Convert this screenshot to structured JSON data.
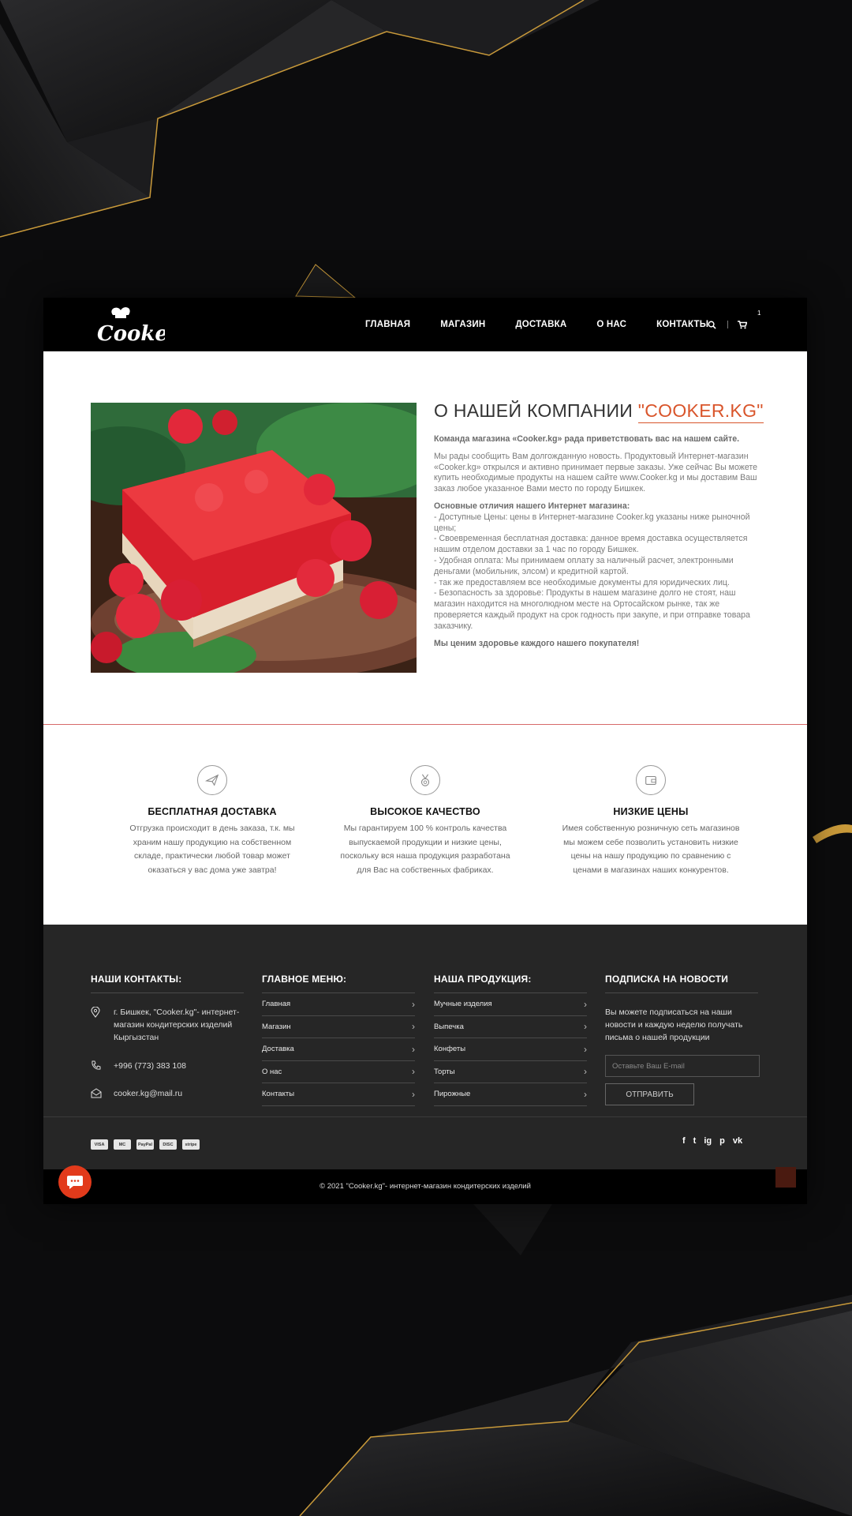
{
  "header": {
    "logo_text": "Cooker",
    "nav": [
      "ГЛАВНАЯ",
      "МАГАЗИН",
      "ДОСТАВКА",
      "О НАС",
      "КОНТАКТЫ"
    ],
    "cart_count": "1"
  },
  "about": {
    "title_prefix": "О НАШЕЙ КОМПАНИИ ",
    "title_accent": "\"COOKER.KG\"",
    "intro": "Команда магазина «Cooker.kg» рада приветствовать вас на нашем сайте.",
    "p1": "Мы рады сообщить Вам долгожданную новость. Продуктовый Интернет-магазин «Cooker.kg» открылся и активно принимает первые заказы. Уже сейчас Вы можете купить необходимые продукты на нашем сайте www.Cooker.kg и мы доставим Ваш заказ любое указанное Вами место по городу Бишкек.",
    "diff_title": "Основные отличия нашего Интернет магазина:",
    "diff_list": [
      "- Доступные Цены: цены в Интернет-магазине Cooker.kg указаны ниже рыночной цены;",
      "- Своевременная бесплатная доставка: данное время доставка осуществляется нашим отделом доставки за 1 час по городу Бишкек.",
      "- Удобная оплата: Мы принимаем оплату за наличный расчет, электронными деньгами (мобильник, элсом) и кредитной картой.",
      "- так же предоставляем все необходимые документы для юридических лиц.",
      "- Безопасность за здоровье: Продукты в нашем магазине долго не стоят, наш магазин находится на многолюдном месте на Ортосайском рынке, так же проверяется каждый продукт на срок годность при закупе, и при отправке товара заказчику."
    ],
    "closing": "Мы ценим здоровье каждого нашего покупателя!"
  },
  "features": [
    {
      "icon": "airplane-icon",
      "title": "БЕСПЛАТНАЯ ДОСТАВКА",
      "text": "Отгрузка происходит в день заказа, т.к. мы храним нашу продукцию на собственном складе, практически любой товар может оказаться у вас дома уже завтра!"
    },
    {
      "icon": "medal-icon",
      "title": "ВЫСОКОЕ КАЧЕСТВО",
      "text": "Мы гарантируем 100 % контроль качества выпускаемой продукции и низкие цены, поскольку вся наша продукция разработана для Вас на собственных фабриках."
    },
    {
      "icon": "wallet-icon",
      "title": "НИЗКИЕ ЦЕНЫ",
      "text": "Имея собственную розничную сеть магазинов мы можем себе позволить установить низкие цены на нашу продукцию по сравнению с ценами в магазинах наших конкурентов."
    }
  ],
  "footer": {
    "contacts_title": "НАШИ КОНТАКТЫ:",
    "address": "г. Бишкек, \"Cooker.kg\"- интернет-магазин кондитерских изделий Кыргызстан",
    "phone": "+996 (773) 383 108",
    "email": "cooker.kg@mail.ru",
    "menu_title": "ГЛАВНОЕ МЕНЮ:",
    "menu": [
      "Главная",
      "Магазин",
      "Доставка",
      "О нас",
      "Контакты"
    ],
    "products_title": "НАША ПРОДУКЦИЯ:",
    "products": [
      "Мучные изделия",
      "Выпечка",
      "Конфеты",
      "Торты",
      "Пирожные"
    ],
    "newsletter_title": "ПОДПИСКА НА НОВОСТИ",
    "newsletter_text": "Вы можете подписаться на наши новости и каждую неделю получать письма о нашей продукции",
    "email_placeholder": "Оставьте Ваш E-mail",
    "submit_label": "ОТПРАВИТЬ",
    "payments": [
      "VISA",
      "MC",
      "PayPal",
      "DISC",
      "stripe"
    ],
    "social": [
      "f",
      "t",
      "ig",
      "p",
      "vk"
    ],
    "copyright": "© 2021 \"Cooker.kg\"- интернет-магазин кондитерских изделий"
  }
}
